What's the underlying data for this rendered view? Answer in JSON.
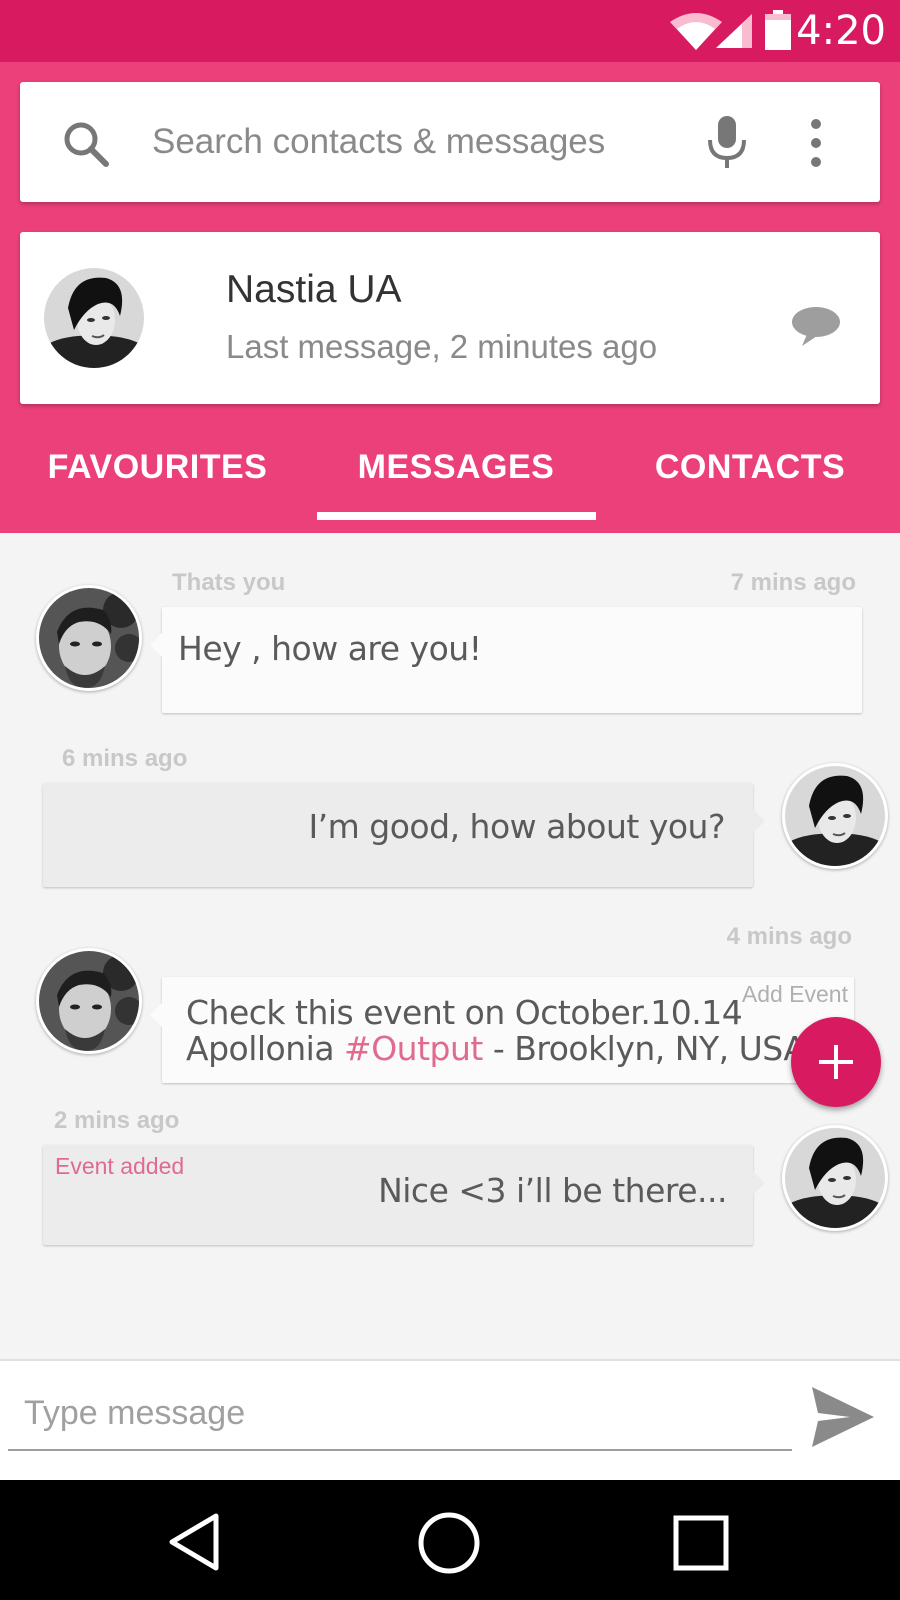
{
  "status_bar": {
    "time": "4:20"
  },
  "search": {
    "placeholder": "Search contacts & messages"
  },
  "contact": {
    "name": "Nastia UA",
    "subtitle": "Last message, 2 minutes ago"
  },
  "tabs": [
    {
      "label": "FAVOURITES"
    },
    {
      "label": "MESSAGES"
    },
    {
      "label": "CONTACTS"
    }
  ],
  "messages": [
    {
      "sender": "Thats you",
      "time": "7 mins ago",
      "text": "Hey , how are you!"
    },
    {
      "time": "6 mins ago",
      "text": "I’m good, how about you?"
    },
    {
      "time": "4 mins ago",
      "action_label": "Add Event",
      "line1": "Check this event on October.10.14",
      "line2_prefix": "Apollonia ",
      "line2_tag": "#Output",
      "line2_suffix": " - Brooklyn, NY, USA"
    },
    {
      "time": "2 mins ago",
      "status_label": "Event added",
      "text": "Nice  <3 i’ll be there..."
    }
  ],
  "compose": {
    "placeholder": "Type message"
  },
  "colors": {
    "status_bar": "#d81b60",
    "header": "#ec407a",
    "accent": "#d81b60",
    "hashtag": "#e06b8f"
  },
  "icons": [
    "wifi-icon",
    "signal-icon",
    "battery-icon",
    "search-icon",
    "mic-icon",
    "more-vert-icon",
    "chat-bubble-icon",
    "plus-icon",
    "send-icon",
    "back-icon",
    "home-icon",
    "recents-icon"
  ]
}
